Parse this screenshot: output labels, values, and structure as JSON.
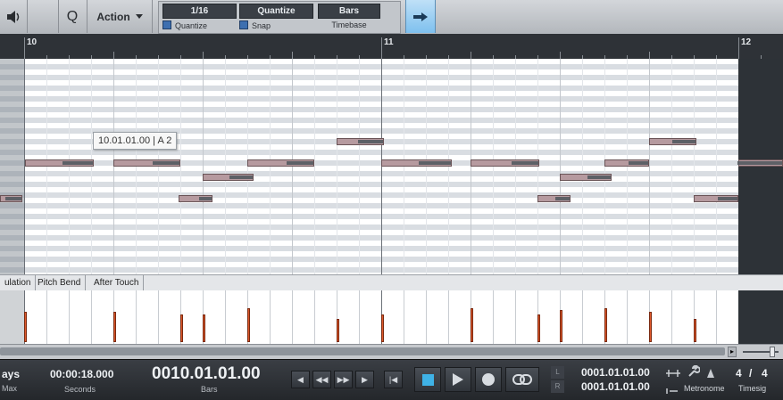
{
  "toolbar": {
    "action_label": "Action",
    "quantize_value": "1/16",
    "quantize_label": "Quantize",
    "snap_value": "Quantize",
    "snap_label": "Snap",
    "timebase_value": "Bars",
    "timebase_label": "Timebase",
    "quantize_toggle_glyph": "Q"
  },
  "ruler": {
    "bars": [
      "10",
      "11",
      "12"
    ]
  },
  "tooltip": "10.01.01.00 | A 2",
  "tabs": [
    "ulation",
    "Pitch Bend",
    "After Touch"
  ],
  "transport": {
    "left_value": "ays",
    "left_sub": "Max",
    "seconds_value": "00:00:18.000",
    "seconds_label": "Seconds",
    "bars_value": "0010.01.01.00",
    "bars_label": "Bars",
    "loop_left_marker": "L",
    "loop_right_marker": "R",
    "loop_start": "0001.01.01.00",
    "loop_end": "0001.01.01.00",
    "metronome_label": "Metronome",
    "timesig_num": "4",
    "timesig_slash": "/",
    "timesig_den": "4",
    "timesig_label": "Timesig"
  },
  "icons": [
    "speaker-icon",
    "search-icon",
    "arrow-right-icon",
    "rewind-icon",
    "fast-forward-icon",
    "stop-icon",
    "play-icon",
    "record-icon",
    "loop-icon",
    "wrench-icon"
  ],
  "colors": {
    "note_fill": "#b69a9f",
    "velocity_bar": "#e0582b",
    "accent_blue": "#3d6fb0"
  }
}
